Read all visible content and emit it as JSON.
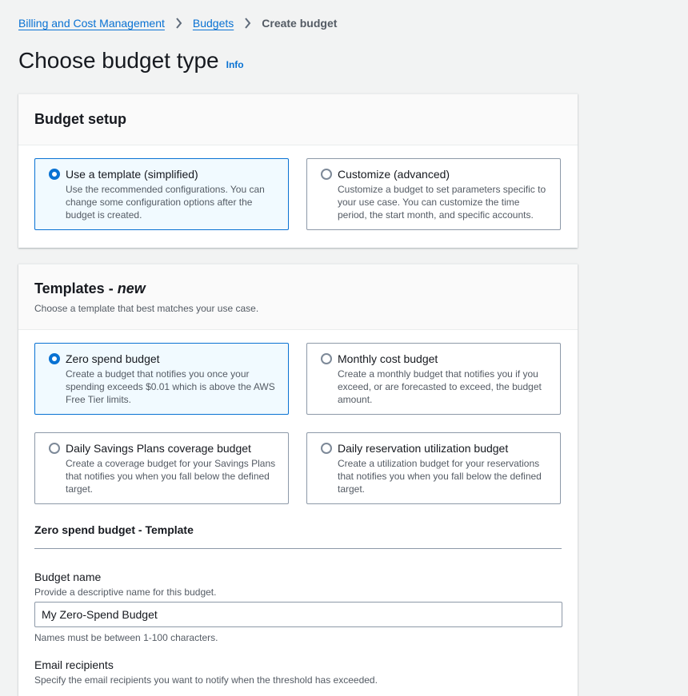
{
  "breadcrumb": {
    "items": [
      "Billing and Cost Management",
      "Budgets"
    ],
    "current": "Create budget"
  },
  "header": {
    "title": "Choose budget type",
    "info": "Info"
  },
  "budget_setup": {
    "title": "Budget setup",
    "options": [
      {
        "label": "Use a template (simplified)",
        "desc": "Use the recommended configurations. You can change some configuration options after the budget is created.",
        "selected": true
      },
      {
        "label": "Customize (advanced)",
        "desc": "Customize a budget to set parameters specific to your use case. You can customize the time period, the start month, and specific accounts.",
        "selected": false
      }
    ]
  },
  "templates": {
    "title": "Templates - ",
    "title_em": "new",
    "desc": "Choose a template that best matches your use case.",
    "options": [
      {
        "label": "Zero spend budget",
        "desc": "Create a budget that notifies you once your spending exceeds $0.01 which is above the AWS Free Tier limits.",
        "selected": true
      },
      {
        "label": "Monthly cost budget",
        "desc": "Create a monthly budget that notifies you if you exceed, or are forecasted to exceed, the budget amount.",
        "selected": false
      },
      {
        "label": "Daily Savings Plans coverage budget",
        "desc": "Create a coverage budget for your Savings Plans that notifies you when you fall below the defined target.",
        "selected": false
      },
      {
        "label": "Daily reservation utilization budget",
        "desc": "Create a utilization budget for your reservations that notifies you when you fall below the defined target.",
        "selected": false
      }
    ],
    "section_title": "Zero spend budget - Template",
    "budget_name": {
      "label": "Budget name",
      "desc": "Provide a descriptive name for this budget.",
      "value": "My Zero-Spend Budget",
      "hint": "Names must be between 1-100 characters."
    },
    "email": {
      "label": "Email recipients",
      "desc": "Specify the email recipients you want to notify when the threshold has exceeded."
    }
  },
  "colors": {
    "accent": "#0972d3",
    "selected_bg": "#f1faff",
    "page_bg": "#f2f3f3"
  }
}
